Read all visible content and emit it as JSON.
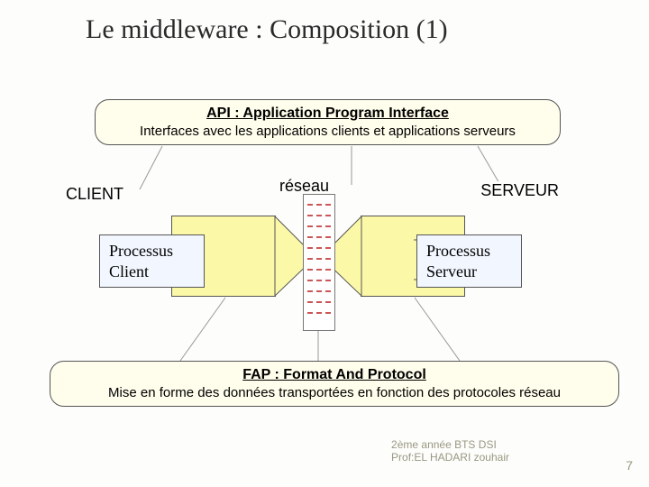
{
  "title": "Le middleware : Composition (1)",
  "api": {
    "header": "API : Application Program Interface",
    "sub": "Interfaces avec les applications clients et applications serveurs"
  },
  "fap": {
    "header": "FAP : Format And Protocol",
    "sub": "Mise en forme des données transportées en fonction des protocoles réseau"
  },
  "labels": {
    "client": "CLIENT",
    "reseau": "réseau",
    "serveur": "SERVEUR",
    "proc_client": "Processus\nClient",
    "proc_server": "Processus\nServeur"
  },
  "footer": {
    "line1": "2ème année BTS DSI",
    "line2": "Prof:EL HADARI zouhair",
    "page": "7"
  }
}
